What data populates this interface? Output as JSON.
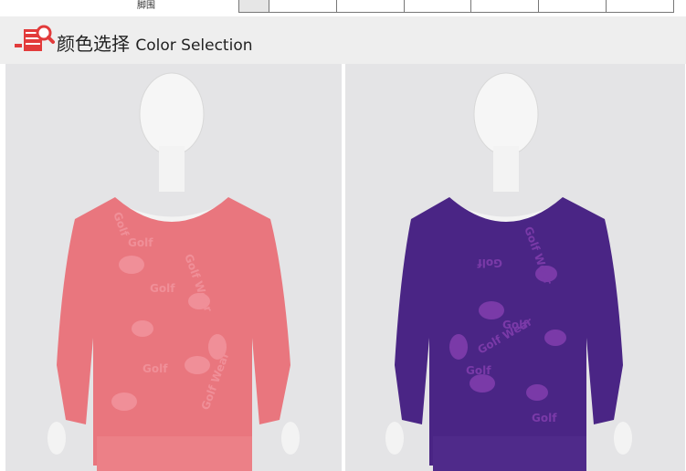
{
  "size_table": {
    "row_label": "脚围",
    "cells": [
      "",
      "",
      "",
      "",
      "",
      "",
      ""
    ]
  },
  "heading": {
    "title_cn": "颜色选择",
    "title_en": "Color Selection",
    "icon": "wardrobe-search-icon"
  },
  "photos": [
    {
      "color_name": "pink",
      "shirt_color": "#e9767e",
      "pattern_color": "#f08f98",
      "print_texts": [
        "Golf",
        "Golf",
        "Golf",
        "Golf",
        "Golf Wear",
        "Golf Wear"
      ]
    },
    {
      "color_name": "purple",
      "shirt_color": "#4a2585",
      "pattern_color": "#7a3aa8",
      "print_texts": [
        "Golf",
        "Golf",
        "Golf",
        "Golf",
        "Golf Wear",
        "Golf Wear"
      ]
    }
  ],
  "colors": {
    "heading_bg": "#eeeeee",
    "icon_red": "#e23b3b",
    "photo_bg": "#e4e4e6"
  }
}
